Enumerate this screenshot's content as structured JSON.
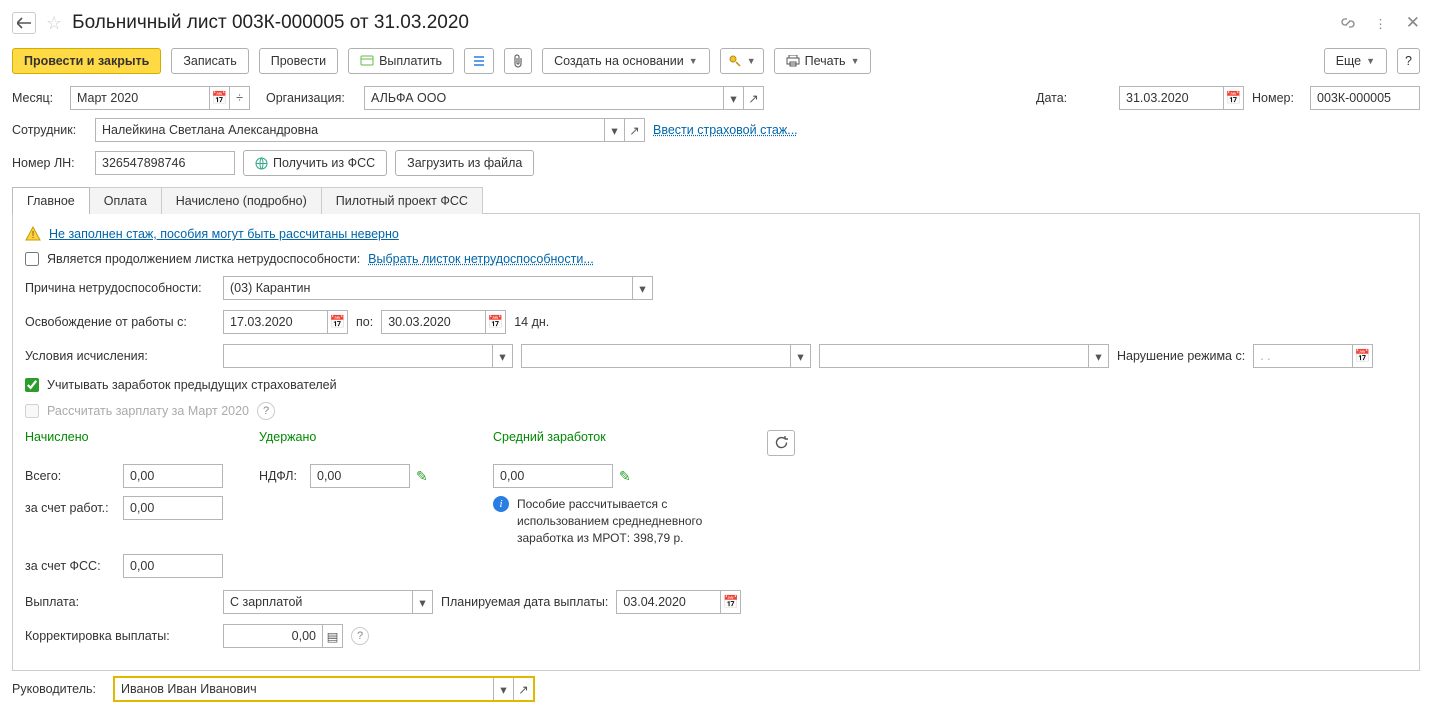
{
  "title": "Больничный лист 003К-000005 от 31.03.2020",
  "toolbar": {
    "apply_close": "Провести и закрыть",
    "save": "Записать",
    "apply": "Провести",
    "pay": "Выплатить",
    "create_from": "Создать на основании",
    "print": "Печать",
    "more": "Еще",
    "help": "?"
  },
  "month": {
    "label": "Месяц:",
    "value": "Март 2020"
  },
  "org": {
    "label": "Организация:",
    "value": "АЛЬФА ООО"
  },
  "date": {
    "label": "Дата:",
    "value": "31.03.2020"
  },
  "number": {
    "label": "Номер:",
    "value": "003К-000005"
  },
  "employee": {
    "label": "Сотрудник:",
    "value": "Налейкина Светлана Александровна",
    "link": "Ввести страховой стаж..."
  },
  "ln": {
    "label": "Номер ЛН:",
    "value": "326547898746",
    "fss": "Получить из ФСС",
    "file": "Загрузить из файла"
  },
  "tabs": [
    "Главное",
    "Оплата",
    "Начислено (подробно)",
    "Пилотный проект ФСС"
  ],
  "active_tab": 0,
  "main": {
    "warn": "Не заполнен стаж, пособия могут быть рассчитаны неверно",
    "continuation": {
      "label": "Является продолжением листка нетрудоспособности:",
      "link": "Выбрать листок нетрудоспособности..."
    },
    "reason": {
      "label": "Причина нетрудоспособности:",
      "value": "(03) Карантин"
    },
    "period": {
      "label": "Освобождение от работы с:",
      "from": "17.03.2020",
      "to_label": "по:",
      "to": "30.03.2020",
      "days": "14 дн."
    },
    "conditions": {
      "label": "Условия исчисления:"
    },
    "violation": {
      "label": "Нарушение режима с:",
      "value": ".  .    "
    },
    "cb_prev": "Учитывать заработок предыдущих страхователей",
    "cb_recalc": "Рассчитать зарплату за Март 2020",
    "calc": {
      "head_accrued": "Начислено",
      "head_withheld": "Удержано",
      "head_avg": "Средний заработок",
      "total_lbl": "Всего:",
      "total": "0,00",
      "employer_lbl": "за счет работ.:",
      "employer": "0,00",
      "fss_lbl": "за счет ФСС:",
      "fss": "0,00",
      "ndfl_lbl": "НДФЛ:",
      "ndfl": "0,00",
      "avg": "0,00",
      "hint": "Пособие рассчитывается с использованием среднедневного заработка из МРОТ: 398,79 р."
    },
    "payment": {
      "label": "Выплата:",
      "value": "С зарплатой",
      "plan_lbl": "Планируемая дата выплаты:",
      "plan_date": "03.04.2020"
    },
    "corr": {
      "label": "Корректировка выплаты:",
      "value": "0,00"
    }
  },
  "manager": {
    "label": "Руководитель:",
    "value": "Иванов Иван Иванович"
  }
}
